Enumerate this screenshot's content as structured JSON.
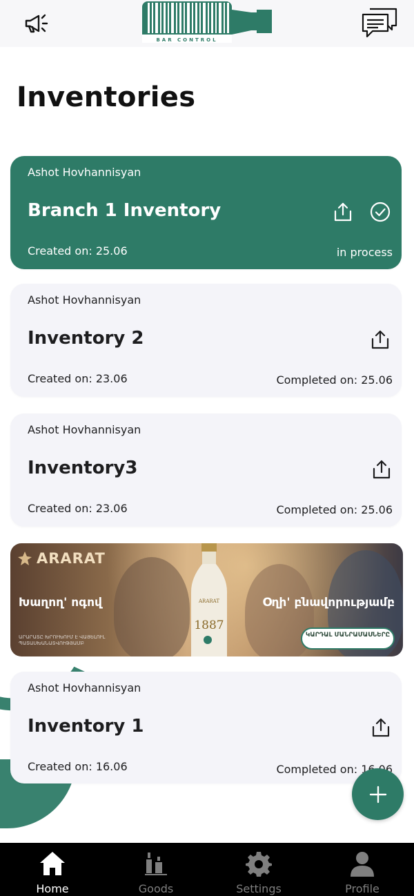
{
  "header": {
    "logo_text": "BAR CONTROL",
    "left_icon": "megaphone-icon",
    "right_icon": "chat-icon"
  },
  "page": {
    "title": "Inventories"
  },
  "cards": [
    {
      "owner": "Ashot Hovhannisyan",
      "name": "Branch 1 Inventory",
      "created": "Created on: 25.06",
      "status": "in process",
      "active": true
    },
    {
      "owner": "Ashot Hovhannisyan",
      "name": "Inventory 2",
      "created": "Created on: 23.06",
      "status": "Completed on: 25.06",
      "active": false
    },
    {
      "owner": "Ashot Hovhannisyan",
      "name": "Inventory3",
      "created": "Created on: 23.06",
      "status": "Completed on: 25.06",
      "active": false
    },
    {
      "owner": "Ashot Hovhannisyan",
      "name": "Inventory 1",
      "created": "Created on: 16.06",
      "status": "Completed on: 16.06",
      "active": false
    }
  ],
  "ad": {
    "brand": "ARARAT",
    "left_text": "Խաղող' ոգով",
    "right_text": "Օղի' բնավորությամբ",
    "fine_print": "ԱՐԱՐԱՏԸ ԽՐՈՒԽՈՒՄ Է ՎԱՅԵԼՈՒԼ ՊԱՏԱՍԽԱՆԱՏՎՈՒԹՅԱՄԲ",
    "bottle_label": "ARARAT",
    "bottle_year": "1887",
    "cta": "ԿԱՐԴԱԼ ՄԱՆՐԱՄԱՍՆԵՐԸ"
  },
  "colors": {
    "accent": "#2e7b67",
    "card_bg": "#f4f4f9",
    "nav_bg": "#000000"
  },
  "nav": {
    "items": [
      {
        "label": "Home",
        "icon": "home-icon",
        "active": true
      },
      {
        "label": "Goods",
        "icon": "bottles-icon",
        "active": false
      },
      {
        "label": "Settings",
        "icon": "gear-icon",
        "active": false
      },
      {
        "label": "Profile",
        "icon": "person-icon",
        "active": false
      }
    ]
  }
}
